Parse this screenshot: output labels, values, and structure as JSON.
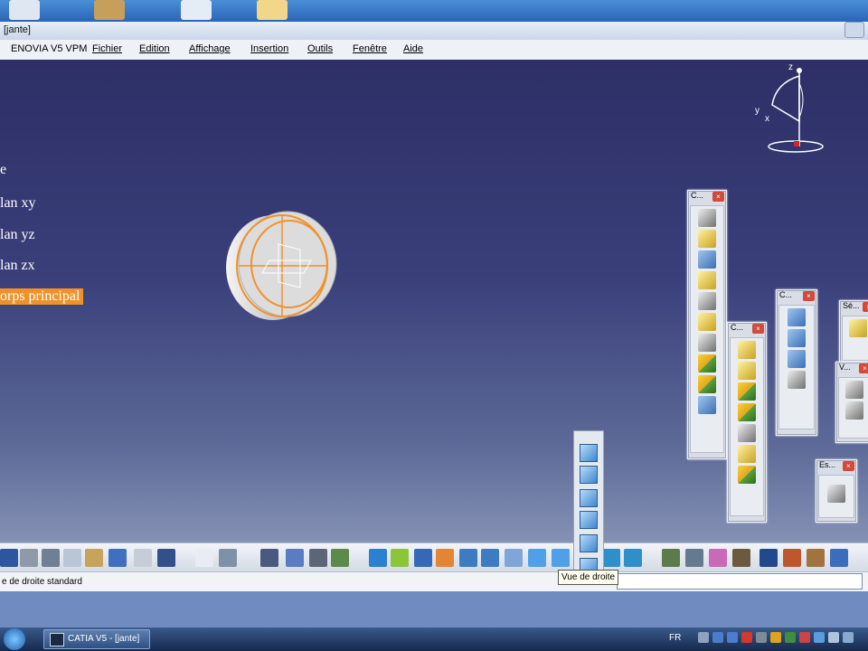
{
  "window": {
    "title": "[jante]"
  },
  "menubar": {
    "items": [
      "ENOVIA V5 VPM",
      "Fichier",
      "Edition",
      "Affichage",
      "Insertion",
      "Outils",
      "Fenêtre",
      "Aide"
    ]
  },
  "tree": {
    "items": [
      "e",
      "lan xy",
      "lan yz",
      "lan zx",
      "orps principal"
    ]
  },
  "compass": {
    "z": "z",
    "y": "y",
    "x": "x"
  },
  "toolboxes": [
    {
      "title": "C..."
    },
    {
      "title": "C..."
    },
    {
      "title": "C..."
    },
    {
      "title": "Sé..."
    },
    {
      "title": "V..."
    },
    {
      "title": "Es..."
    }
  ],
  "tooltip": {
    "text": "Vue de droite"
  },
  "statusbar": {
    "text": "e de droite standard"
  },
  "taskbar": {
    "app_label": "CATIA V5 - [jante]",
    "lang": "FR"
  },
  "colors": {
    "accent": "#f0922a",
    "viewport_top": "#2d2f66",
    "viewport_bottom": "#8591b4"
  }
}
